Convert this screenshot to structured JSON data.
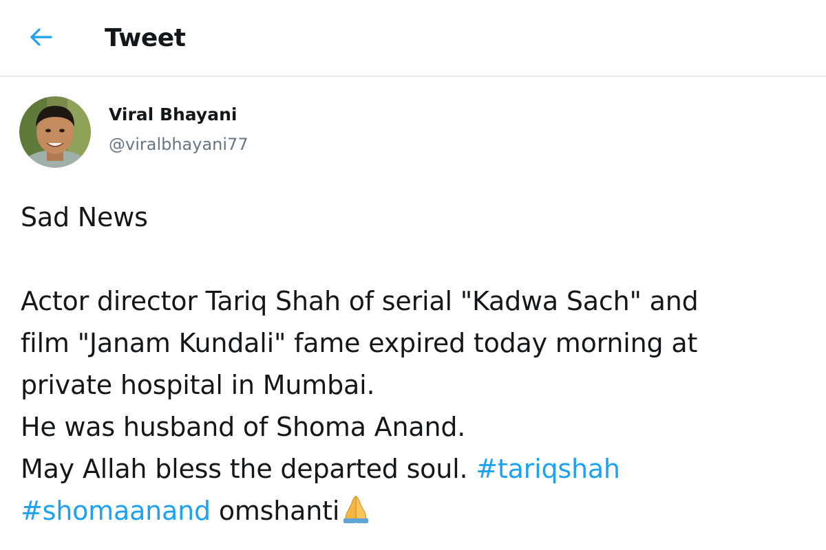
{
  "header": {
    "title": "Tweet",
    "back_icon": "arrow-left-icon",
    "accent_color": "#1da1f2"
  },
  "author": {
    "name": "Viral Bhayani",
    "handle": "@viralbhayani77",
    "avatar_icon": "avatar"
  },
  "tweet": {
    "headline": "Sad News",
    "lines": [
      "Actor director Tariq Shah of serial \"Kadwa Sach\" and",
      "film \"Janam Kundali\" fame expired today morning at",
      "private hospital in Mumbai.",
      "He was husband of Shoma Anand."
    ],
    "line5_text": "May Allah bless the departed soul. ",
    "hashtag_1": "#tariqshah",
    "hashtag_2": "#shomaanand",
    "closing_text": " omshanti",
    "closing_emoji_icon": "folded-hands-icon",
    "text_color": "#14171a",
    "link_color": "#1da1f2"
  }
}
